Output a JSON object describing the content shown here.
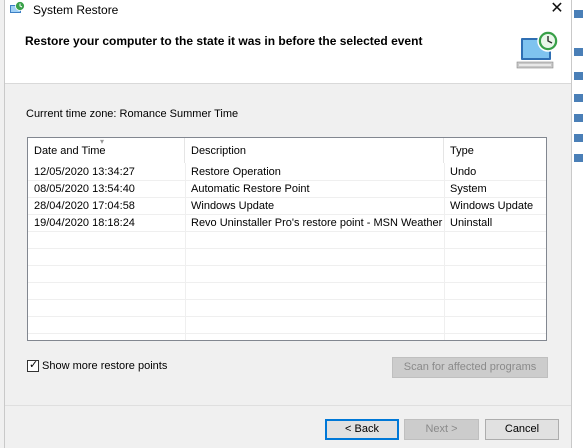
{
  "window": {
    "title": "System Restore",
    "close_glyph": "✕"
  },
  "header": {
    "heading": "Restore your computer to the state it was in before the selected event",
    "icon": "system-restore-computer-icon"
  },
  "timezone_label": "Current time zone: Romance Summer Time",
  "list": {
    "columns": [
      "Date and Time",
      "Description",
      "Type"
    ],
    "sort_glyph": "▾",
    "rows": [
      [
        "12/05/2020 13:34:27",
        "Restore Operation",
        "Undo"
      ],
      [
        "08/05/2020 13:54:40",
        "Automatic Restore Point",
        "System"
      ],
      [
        "28/04/2020 17:04:58",
        "Windows Update",
        "Windows Update"
      ],
      [
        "19/04/2020 18:18:24",
        "Revo Uninstaller Pro's restore point - MSN Weather",
        "Uninstall"
      ]
    ]
  },
  "show_more": {
    "label": "Show more restore points",
    "checked": true,
    "check_glyph": "✓"
  },
  "buttons": {
    "scan": "Scan for affected programs",
    "back": "< Back",
    "next": "Next >",
    "cancel": "Cancel"
  },
  "colors": {
    "accent": "#0078d7",
    "list_border": "#828790",
    "disabled_text": "#8a8a8a"
  }
}
